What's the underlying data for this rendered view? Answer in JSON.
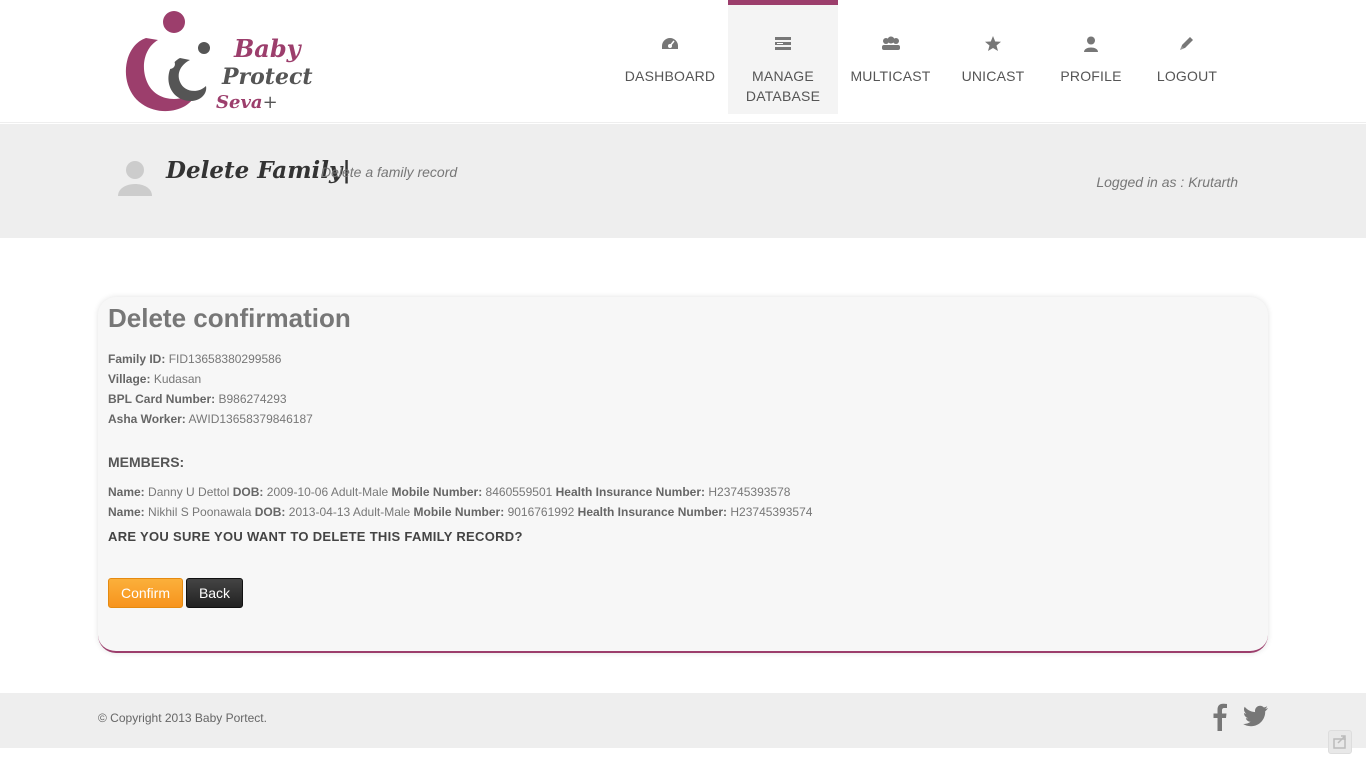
{
  "logo": {
    "line1": "Baby",
    "line2": "Protect",
    "line3": "Seva",
    "plus": "+"
  },
  "nav": [
    {
      "label": "DASHBOARD",
      "icon": "dashboard-icon"
    },
    {
      "label": "MANAGE\nDATABASE",
      "icon": "database-icon"
    },
    {
      "label": "MULTICAST",
      "icon": "group-icon"
    },
    {
      "label": "UNICAST",
      "icon": "star-icon"
    },
    {
      "label": "PROFILE",
      "icon": "user-icon"
    },
    {
      "label": "LOGOUT",
      "icon": "pencil-icon"
    }
  ],
  "band": {
    "title": "Delete Family|",
    "subtitle": "Delete a family record",
    "logged_in": "Logged in as : Krutarth"
  },
  "confirm": {
    "heading": "Delete confirmation",
    "family_id_label": "Family ID:",
    "family_id": "FID13658380299586",
    "village_label": "Village:",
    "village": "Kudasan",
    "bpl_label": "BPL Card Number:",
    "bpl": "B986274293",
    "asha_label": "Asha Worker:",
    "asha": "AWID13658379846187",
    "members_title": "MEMBERS:",
    "labels": {
      "name": "Name:",
      "dob": "DOB:",
      "mobile": "Mobile Number:",
      "insurance": "Health Insurance Number:"
    },
    "members": [
      {
        "name": "Danny U Dettol",
        "dob": "2009-10-06",
        "type": "Adult-Male",
        "mobile": "8460559501",
        "insurance": "H23745393578"
      },
      {
        "name": "Nikhil S Poonawala",
        "dob": "2013-04-13",
        "type": "Adult-Male",
        "mobile": "9016761992",
        "insurance": "H23745393574"
      }
    ],
    "question": "ARE YOU SURE YOU WANT TO DELETE THIS FAMILY RECORD?",
    "confirm_label": "Confirm",
    "back_label": "Back"
  },
  "footer": {
    "copyright": "© Copyright 2013 Baby Portect."
  },
  "colors": {
    "accent": "#9c3e6c",
    "confirm": "#f7941d"
  }
}
